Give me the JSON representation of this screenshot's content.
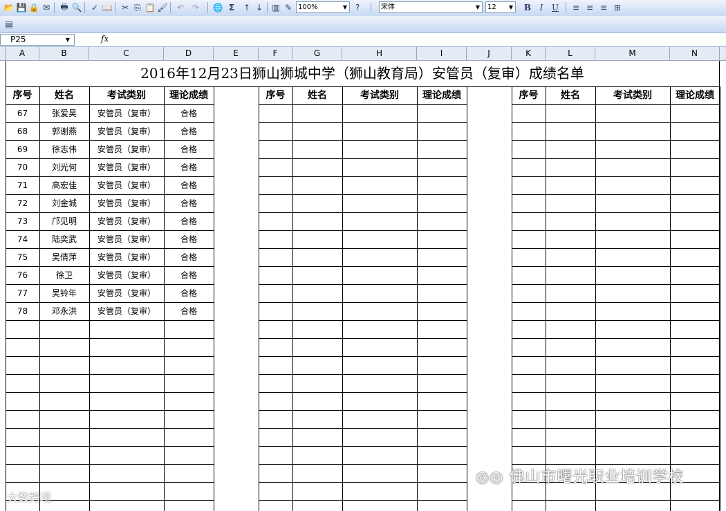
{
  "toolbar": {
    "zoom": "100%",
    "font_name": "宋体",
    "font_size": "12",
    "bold": "B",
    "italic": "I",
    "underline": "U",
    "sigma": "Σ"
  },
  "formula": {
    "cell_ref": "P25",
    "fx": "fx"
  },
  "columns": [
    "A",
    "B",
    "C",
    "D",
    "E",
    "F",
    "G",
    "H",
    "I",
    "J",
    "K",
    "L",
    "M",
    "N"
  ],
  "sheet": {
    "title": "2016年12月23日狮山狮城中学（狮山教育局）安管员（复审）成绩名单",
    "headers": [
      "序号",
      "姓名",
      "考试类别",
      "理论成绩"
    ],
    "rows": [
      {
        "no": "67",
        "name": "张爱昊",
        "type": "安管员（复审）",
        "score": "合格"
      },
      {
        "no": "68",
        "name": "郭谢燕",
        "type": "安管员（复审）",
        "score": "合格"
      },
      {
        "no": "69",
        "name": "徐志伟",
        "type": "安管员（复审）",
        "score": "合格"
      },
      {
        "no": "70",
        "name": "刘光何",
        "type": "安管员（复审）",
        "score": "合格"
      },
      {
        "no": "71",
        "name": "高宏佳",
        "type": "安管员（复审）",
        "score": "合格"
      },
      {
        "no": "72",
        "name": "刘金城",
        "type": "安管员（复审）",
        "score": "合格"
      },
      {
        "no": "73",
        "name": "邝见明",
        "type": "安管员（复审）",
        "score": "合格"
      },
      {
        "no": "74",
        "name": "陆奕武",
        "type": "安管员（复审）",
        "score": "合格"
      },
      {
        "no": "75",
        "name": "吴倩萍",
        "type": "安管员（复审）",
        "score": "合格"
      },
      {
        "no": "76",
        "name": "徐卫",
        "type": "安管员（复审）",
        "score": "合格"
      },
      {
        "no": "77",
        "name": "吴铃年",
        "type": "安管员（复审）",
        "score": "合格"
      },
      {
        "no": "78",
        "name": "邓永洪",
        "type": "安管员（复审）",
        "score": "合格"
      }
    ]
  },
  "watermark": {
    "right": "佛山市曙光职业培训学校",
    "left": "大数跨境"
  }
}
